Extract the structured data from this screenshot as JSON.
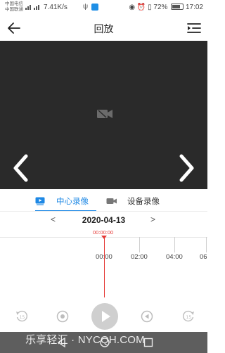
{
  "status_bar": {
    "carrier_1": "中国电信",
    "carrier_2": "中国联通",
    "signal_1": "4G",
    "signal_2": "4G",
    "net_speed": "7.41K/s",
    "battery": "72%",
    "time": "17:02"
  },
  "header": {
    "title": "回放",
    "back_icon": "arrow-left-icon",
    "menu_icon": "playlist-icon"
  },
  "player": {
    "background": "#2a2a2a",
    "placeholder_icon": "video-camera-icon",
    "prev_icon": "chevron-left-icon",
    "next_icon": "chevron-right-icon"
  },
  "tabs": {
    "active_color": "#1e88e5",
    "items": [
      {
        "label": "中心录像",
        "icon": "cloud-video-icon"
      },
      {
        "label": "设备录像",
        "icon": "camera-video-icon"
      }
    ]
  },
  "date_selector": {
    "prev": "<",
    "value": "2020-04-13",
    "next": ">"
  },
  "timeline": {
    "current_time": "00:00:00",
    "cursor_color": "#e53935",
    "ticks": [
      {
        "label": "00:00"
      },
      {
        "label": "02:00"
      },
      {
        "label": "04:00"
      },
      {
        "label": "06"
      }
    ]
  },
  "controls": {
    "items": [
      "rewind-15s-icon",
      "record-icon",
      "play-icon",
      "audio-icon",
      "forward-15s-icon"
    ]
  },
  "watermark": {
    "text": "乐享轻汇 · NYCQH.COM"
  }
}
